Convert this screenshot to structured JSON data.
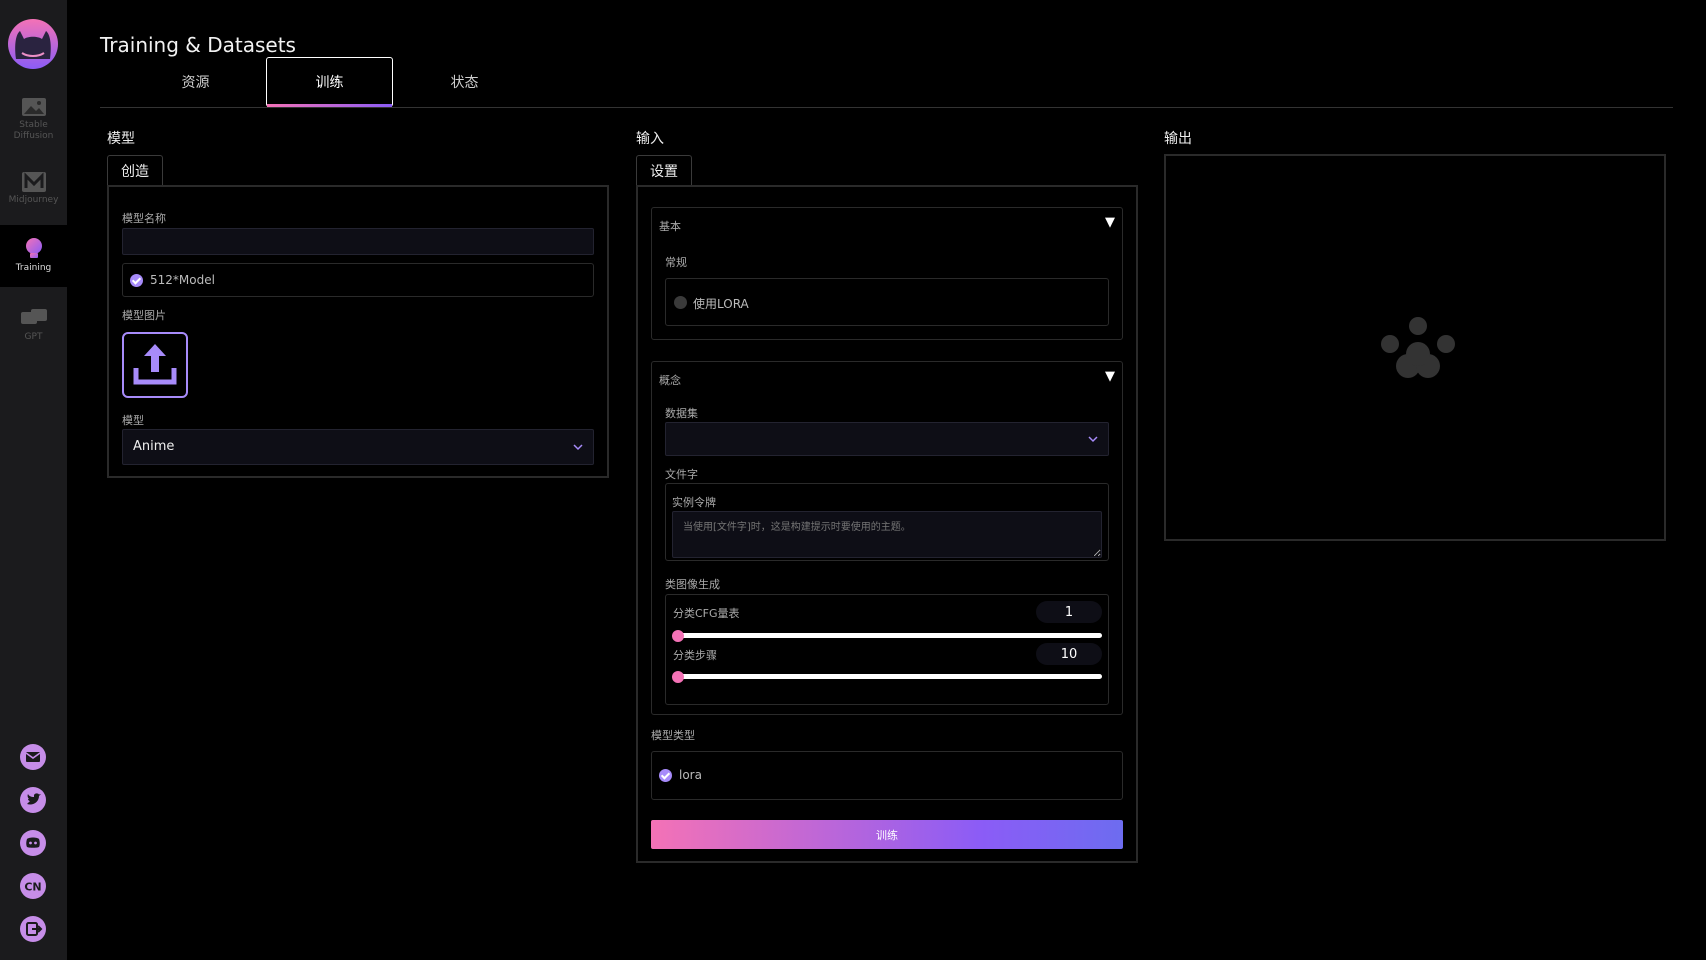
{
  "sidebar": {
    "items": [
      {
        "label_1": "Stable",
        "label_2": "Diffusion",
        "icon": "image-icon"
      },
      {
        "label": "Midjourney",
        "icon": "m-logo-icon"
      },
      {
        "label": "Training",
        "icon": "lightbulb-icon"
      },
      {
        "label": "GPT",
        "icon": "chat-icon"
      }
    ],
    "bottom": [
      "mail-icon",
      "twitter-icon",
      "discord-icon",
      "cn-language-icon",
      "logout-icon"
    ]
  },
  "page": {
    "title": "Training & Datasets"
  },
  "tabs": [
    {
      "label": "资源"
    },
    {
      "label": "训练"
    },
    {
      "label": "状态"
    }
  ],
  "model_col": {
    "label": "模型",
    "subtab": "创造",
    "name_label": "模型名称",
    "checkbox_label": "512*Model",
    "image_label": "模型图片",
    "select_label": "模型",
    "select_value": "Anime"
  },
  "input_col": {
    "label": "输入",
    "subtab": "设置",
    "basic": {
      "title": "基本",
      "general": "常规",
      "lora_label": "使用LORA"
    },
    "concept": {
      "title": "概念",
      "dataset_label": "数据集",
      "filewords_label": "文件字",
      "instance_token_label": "实例令牌",
      "instance_token_placeholder": "当使用[文件字]时，这是构建提示时要使用的主题。",
      "class_gen_label": "类图像生成",
      "cfg_label": "分类CFG量表",
      "cfg_value": "1",
      "steps_label": "分类步骤",
      "steps_value": "10"
    },
    "model_type_label": "模型类型",
    "model_type_value": "lora",
    "train_button": "训练"
  },
  "output_col": {
    "label": "输出"
  },
  "colors": {
    "accent_pink": "#f472b6",
    "accent_purple": "#8b5cf6"
  }
}
